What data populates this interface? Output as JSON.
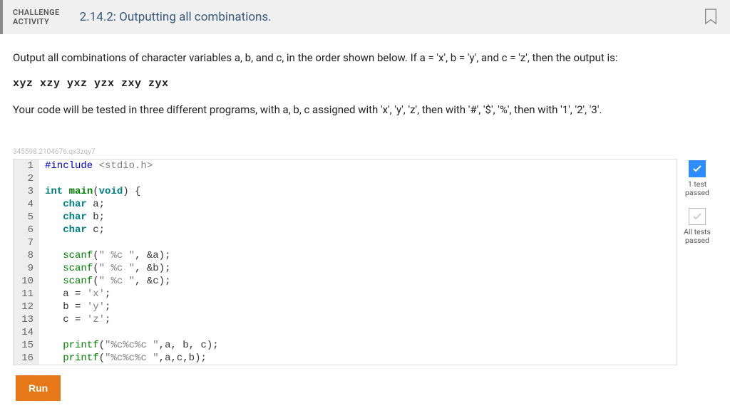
{
  "header": {
    "label_line1": "CHALLENGE",
    "label_line2": "ACTIVITY",
    "title": "2.14.2: Outputting all combinations."
  },
  "instructions": {
    "p1": "Output all combinations of character variables a, b, and c, in the order shown below. If a = 'x', b = 'y', and c = 'z', then the output is:",
    "sample_output": "xyz xzy yxz yzx zxy zyx",
    "p2": "Your code will be tested in three different programs, with a, b, c assigned with 'x', 'y', 'z', then with '#', '$', '%', then with '1', '2', '3'."
  },
  "tiny_id": "345598.2104676.qx3zqy7",
  "code": {
    "lines": [
      {
        "n": 1,
        "tokens": [
          [
            "k-blue",
            "#include"
          ],
          [
            "k-norm",
            " "
          ],
          [
            "k-str",
            "<stdio.h>"
          ]
        ]
      },
      {
        "n": 2,
        "tokens": []
      },
      {
        "n": 3,
        "tokens": [
          [
            "k-teal",
            "int"
          ],
          [
            "k-norm",
            " "
          ],
          [
            "k-green",
            "main"
          ],
          [
            "k-norm",
            "("
          ],
          [
            "k-teal",
            "void"
          ],
          [
            "k-norm",
            ") {"
          ]
        ]
      },
      {
        "n": 4,
        "tokens": [
          [
            "k-norm",
            "   "
          ],
          [
            "k-teal",
            "char"
          ],
          [
            "k-norm",
            " a;"
          ]
        ]
      },
      {
        "n": 5,
        "tokens": [
          [
            "k-norm",
            "   "
          ],
          [
            "k-teal",
            "char"
          ],
          [
            "k-norm",
            " b;"
          ]
        ]
      },
      {
        "n": 6,
        "tokens": [
          [
            "k-norm",
            "   "
          ],
          [
            "k-teal",
            "char"
          ],
          [
            "k-norm",
            " c;"
          ]
        ]
      },
      {
        "n": 7,
        "tokens": []
      },
      {
        "n": 8,
        "tokens": [
          [
            "k-norm",
            "   "
          ],
          [
            "k-fn",
            "scanf"
          ],
          [
            "k-norm",
            "("
          ],
          [
            "k-str",
            "\" %c \""
          ],
          [
            "k-norm",
            ", &a);"
          ]
        ]
      },
      {
        "n": 9,
        "tokens": [
          [
            "k-norm",
            "   "
          ],
          [
            "k-fn",
            "scanf"
          ],
          [
            "k-norm",
            "("
          ],
          [
            "k-str",
            "\" %c \""
          ],
          [
            "k-norm",
            ", &b);"
          ]
        ]
      },
      {
        "n": 10,
        "tokens": [
          [
            "k-norm",
            "   "
          ],
          [
            "k-fn",
            "scanf"
          ],
          [
            "k-norm",
            "("
          ],
          [
            "k-str",
            "\" %c \""
          ],
          [
            "k-norm",
            ", &c);"
          ]
        ]
      },
      {
        "n": 11,
        "tokens": [
          [
            "k-norm",
            "   a = "
          ],
          [
            "k-chr",
            "'x'"
          ],
          [
            "k-norm",
            ";"
          ]
        ]
      },
      {
        "n": 12,
        "tokens": [
          [
            "k-norm",
            "   b = "
          ],
          [
            "k-chr",
            "'y'"
          ],
          [
            "k-norm",
            ";"
          ]
        ]
      },
      {
        "n": 13,
        "tokens": [
          [
            "k-norm",
            "   c = "
          ],
          [
            "k-chr",
            "'z'"
          ],
          [
            "k-norm",
            ";"
          ]
        ]
      },
      {
        "n": 14,
        "tokens": []
      },
      {
        "n": 15,
        "tokens": [
          [
            "k-norm",
            "   "
          ],
          [
            "k-fn",
            "printf"
          ],
          [
            "k-norm",
            "("
          ],
          [
            "k-str",
            "\"%c%c%c \""
          ],
          [
            "k-norm",
            ",a, b, c);"
          ]
        ]
      },
      {
        "n": 16,
        "tokens": [
          [
            "k-norm",
            "   "
          ],
          [
            "k-fn",
            "printf"
          ],
          [
            "k-norm",
            "("
          ],
          [
            "k-str",
            "\"%c%c%c \""
          ],
          [
            "k-norm",
            ",a,c,b);"
          ]
        ]
      }
    ]
  },
  "status": {
    "one_test_label": "1 test passed",
    "all_tests_label": "All tests passed"
  },
  "buttons": {
    "run": "Run"
  }
}
